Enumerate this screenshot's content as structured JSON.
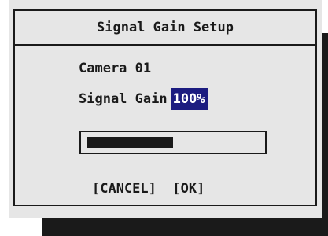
{
  "dialog": {
    "title": "Signal Gain Setup",
    "camera_label": "Camera 01",
    "gain_label": "Signal Gain",
    "gain_value": "100%",
    "gain_level_fraction": 0.5,
    "cancel_label": "[CANCEL]",
    "ok_label": "[OK]"
  },
  "colors": {
    "background": "#e6e6e6",
    "text": "#1a1a1a",
    "highlight": "#1c1c80",
    "highlight_text": "#ffffff",
    "shadow": "#1a1a1a"
  }
}
